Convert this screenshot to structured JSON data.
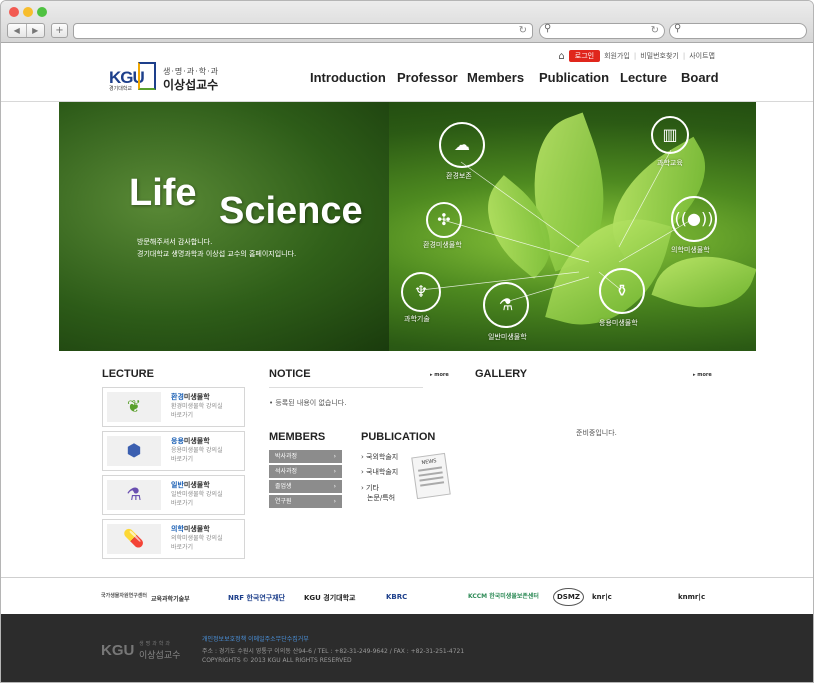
{
  "browser": {
    "nav_back": "◀",
    "nav_forward": "▶",
    "new_tab": "+",
    "reload": "↻",
    "search_icon": "search-icon"
  },
  "header": {
    "util": {
      "login": "로그인",
      "join": "회원가입",
      "find_password": "비밀번호찾기",
      "sitemap": "사이트맵"
    },
    "logo": {
      "kgu": "KGU",
      "kgu_sub": "경기대학교",
      "tagline": "생·명·과·학·과",
      "name": "이상섭교수"
    },
    "nav": [
      "Introduction",
      "Professor",
      "Members",
      "Publication",
      "Lecture",
      "Board"
    ]
  },
  "hero": {
    "title_1": "Life",
    "title_2": "Science",
    "sub_1": "방문해주셔서 감사합니다.",
    "sub_2": "경기대학교 생명과학과 이상섭 교수의 홈페이지입니다.",
    "nodes": [
      "환경보존",
      "과학교육",
      "환경미생물학",
      "의학미생물학",
      "과학기술",
      "일반미생물학",
      "응용미생물학"
    ]
  },
  "lecture": {
    "title": "LECTURE",
    "items": [
      {
        "head": "환경",
        "tail": "미생물학",
        "desc1": "환경미생물학 강의실",
        "desc2": "바로가기"
      },
      {
        "head": "응용",
        "tail": "미생물학",
        "desc1": "응용미생물학 강의실",
        "desc2": "바로가기"
      },
      {
        "head": "일반",
        "tail": "미생물학",
        "desc1": "일반미생물학 강의실",
        "desc2": "바로가기"
      },
      {
        "head": "의학",
        "tail": "미생물학",
        "desc1": "의학미생물학 강의실",
        "desc2": "바로가기"
      }
    ]
  },
  "notice": {
    "title": "NOTICE",
    "more": "▸ more",
    "empty": "• 등록된 내용이 없습니다."
  },
  "members": {
    "title": "MEMBERS",
    "items": [
      "박사과정",
      "석사과정",
      "졸업생",
      "연구원"
    ],
    "arrow": "›"
  },
  "publication": {
    "title": "PUBLICATION",
    "items": [
      "› 국외학술지",
      "› 국내학술지",
      "› 기타",
      "논문/특허"
    ],
    "news_label": "NEWS"
  },
  "gallery": {
    "title": "GALLERY",
    "more": "▸ more",
    "empty": "준비중입니다."
  },
  "partners": [
    "국가생물자원연구센터",
    "교육과학기술부",
    "NRF 한국연구재단",
    "KGU 경기대학교",
    "KBRC",
    "KCCM 한국미생물보존센터",
    "DSMZ",
    "knr|c",
    "knmr|c"
  ],
  "footer": {
    "kgu": "KGU",
    "tag": "생명과학과",
    "name": "이상섭교수",
    "links": "개인정보보호정책  이메일주소무단수집거부",
    "address": "주소 : 경기도 수원시 영통구 이의동 산94-6 / TEL : +82-31-249-9642 / FAX : +82-31-251-4721",
    "copyright": "COPYRIGHTS © 2013 KGU  ALL RIGHTS RESERVED"
  },
  "colors": {
    "accent_red": "#e0261c",
    "brand_blue": "#1d3f8b",
    "footer_bg": "#2c2c2c",
    "member_btn": "#8c8c8c"
  }
}
